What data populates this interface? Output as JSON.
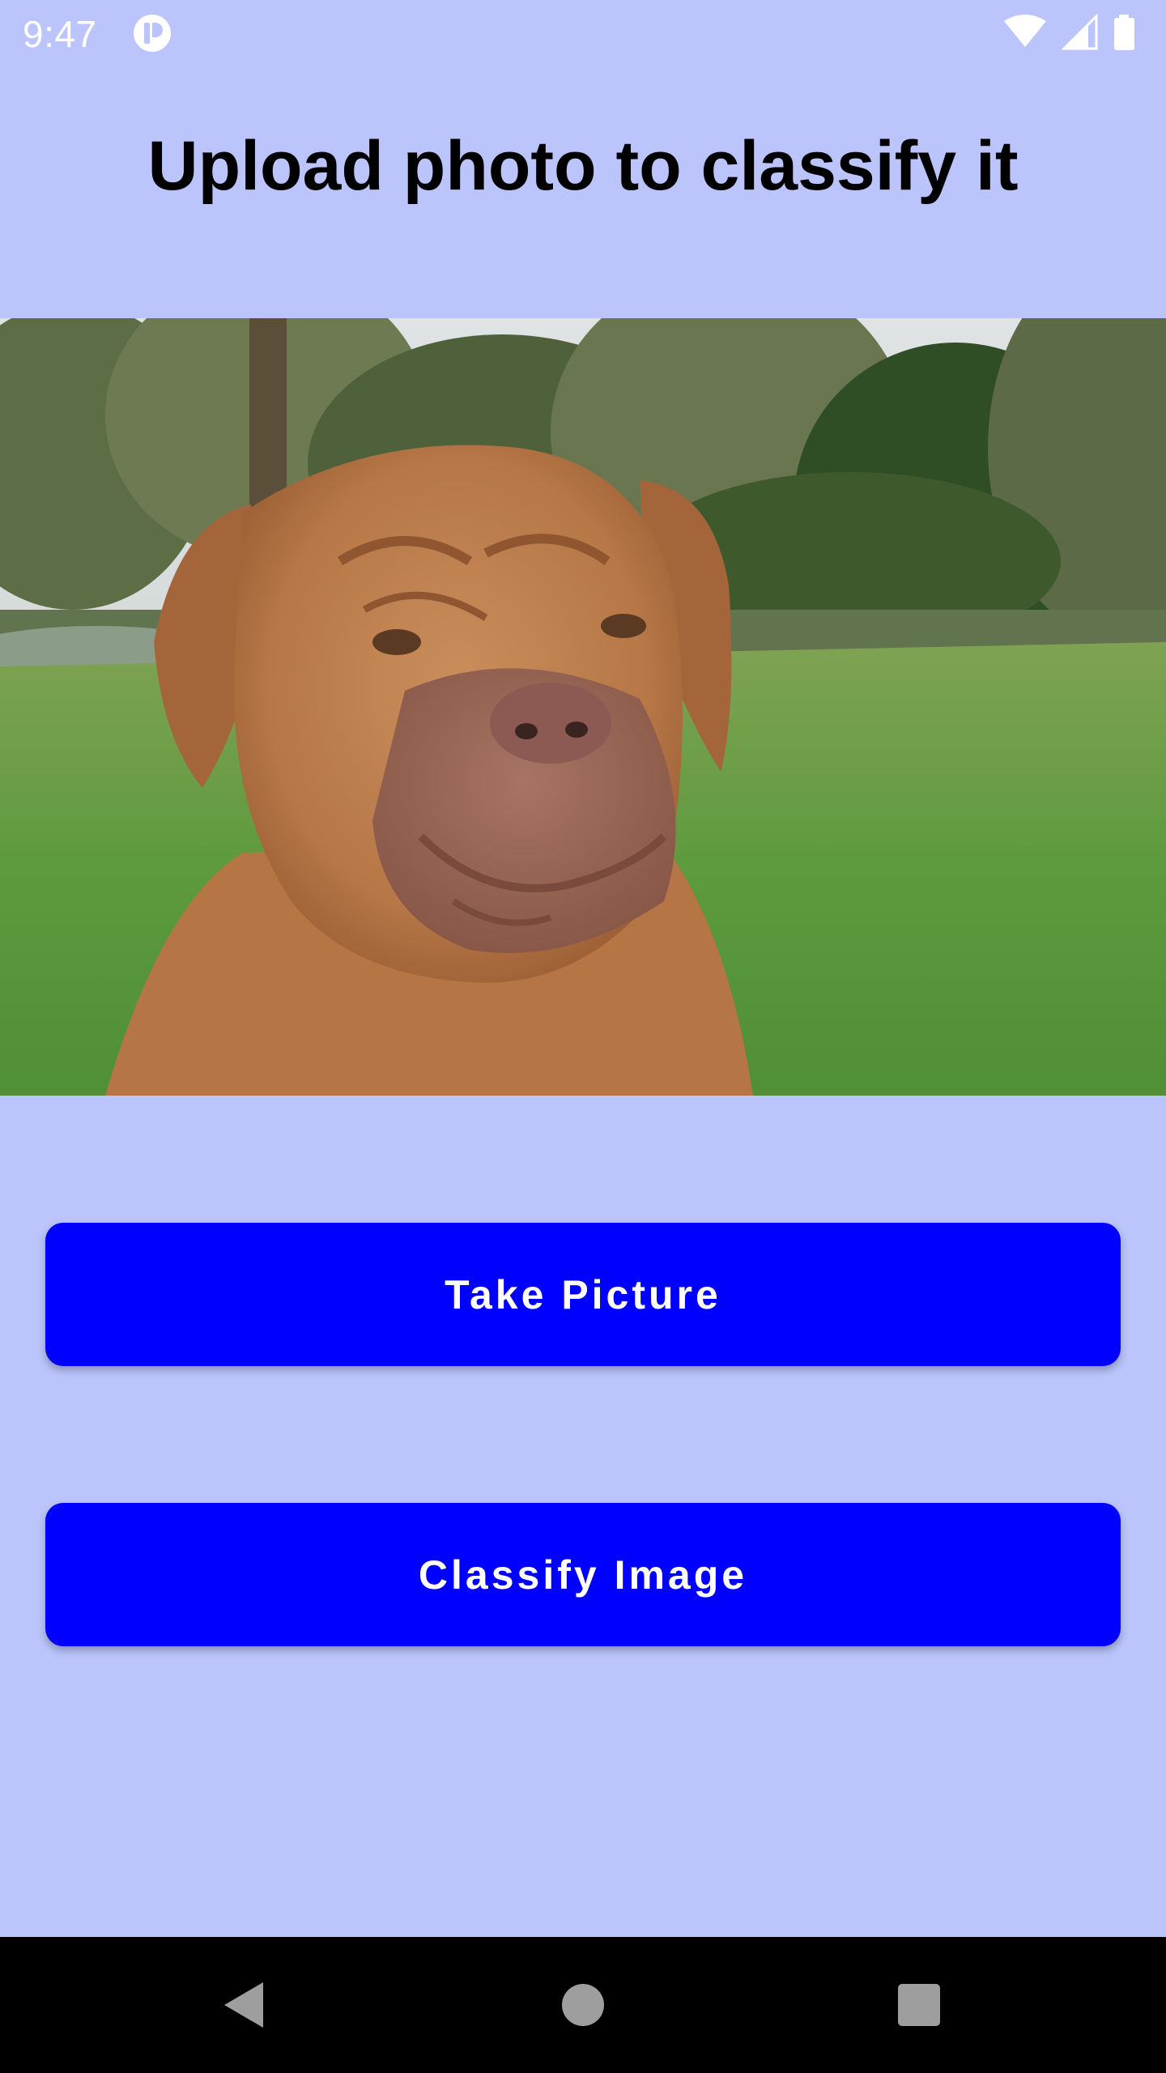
{
  "status_bar": {
    "time": "9:47",
    "icons": [
      "app-notification-icon",
      "wifi-icon",
      "cellular-signal-icon",
      "battery-icon"
    ]
  },
  "page": {
    "title": "Upload photo to classify it",
    "background_color": "#BBC5FB"
  },
  "photo": {
    "subject": "dog-photo"
  },
  "buttons": {
    "take_picture": "Take Picture",
    "classify_image": "Classify Image",
    "color": "#0000FF",
    "text_color": "#FFFFFF"
  },
  "nav_bar": {
    "icons": [
      "back-icon",
      "home-icon",
      "recents-icon"
    ]
  }
}
